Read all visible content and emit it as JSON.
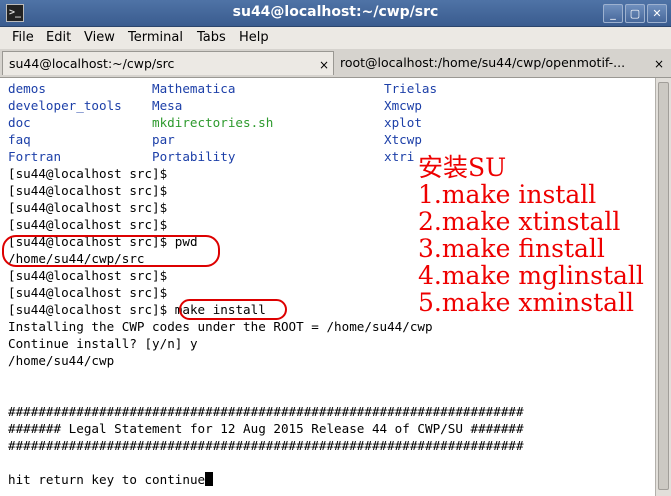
{
  "window": {
    "title": "su44@localhost:~/cwp/src",
    "app_icon": "terminal-icon",
    "controls": [
      "minimize-icon",
      "maximize-icon",
      "close-icon"
    ]
  },
  "menu": [
    "File",
    "Edit",
    "View",
    "Terminal",
    "Tabs",
    "Help"
  ],
  "tabs": [
    {
      "label": "su44@localhost:~/cwp/src",
      "active": true,
      "close": "×"
    },
    {
      "label": "root@localhost:/home/su44/cwp/openmotif-...",
      "active": false,
      "close": "×"
    }
  ],
  "listing": [
    [
      "demos",
      "Mathematica",
      "Trielas"
    ],
    [
      "developer_tools",
      "Mesa",
      "Xmcwp"
    ],
    [
      "doc",
      "mkdirectories.sh",
      "xplot"
    ],
    [
      "faq",
      "par",
      "Xtcwp"
    ],
    [
      "Fortran",
      "Portability",
      "xtri"
    ]
  ],
  "lines": [
    "[su44@localhost src]$",
    "[su44@localhost src]$",
    "[su44@localhost src]$",
    "[su44@localhost src]$",
    "[su44@localhost src]$ pwd",
    "/home/su44/cwp/src",
    "[su44@localhost src]$",
    "[su44@localhost src]$",
    "[su44@localhost src]$ make install",
    "Installing the CWP codes under the ROOT = /home/su44/cwp",
    "Continue install? [y/n] y",
    "/home/su44/cwp",
    "",
    "",
    "####################################################################",
    "####### Legal Statement for 12 Aug 2015 Release 44 of CWP/SU #######",
    "####################################################################",
    "",
    "hit return key to continue"
  ],
  "annotation": [
    "安装SU",
    "1.make install",
    "2.make xtinstall",
    "3.make finstall",
    "4.make mglinstall",
    "5.make xminstall"
  ],
  "colors": {
    "annotation": "#e00000",
    "dir_blue": "#1c3fa8",
    "exec_green": "#2e9a2e",
    "titlebar": "#3a5c8f"
  }
}
